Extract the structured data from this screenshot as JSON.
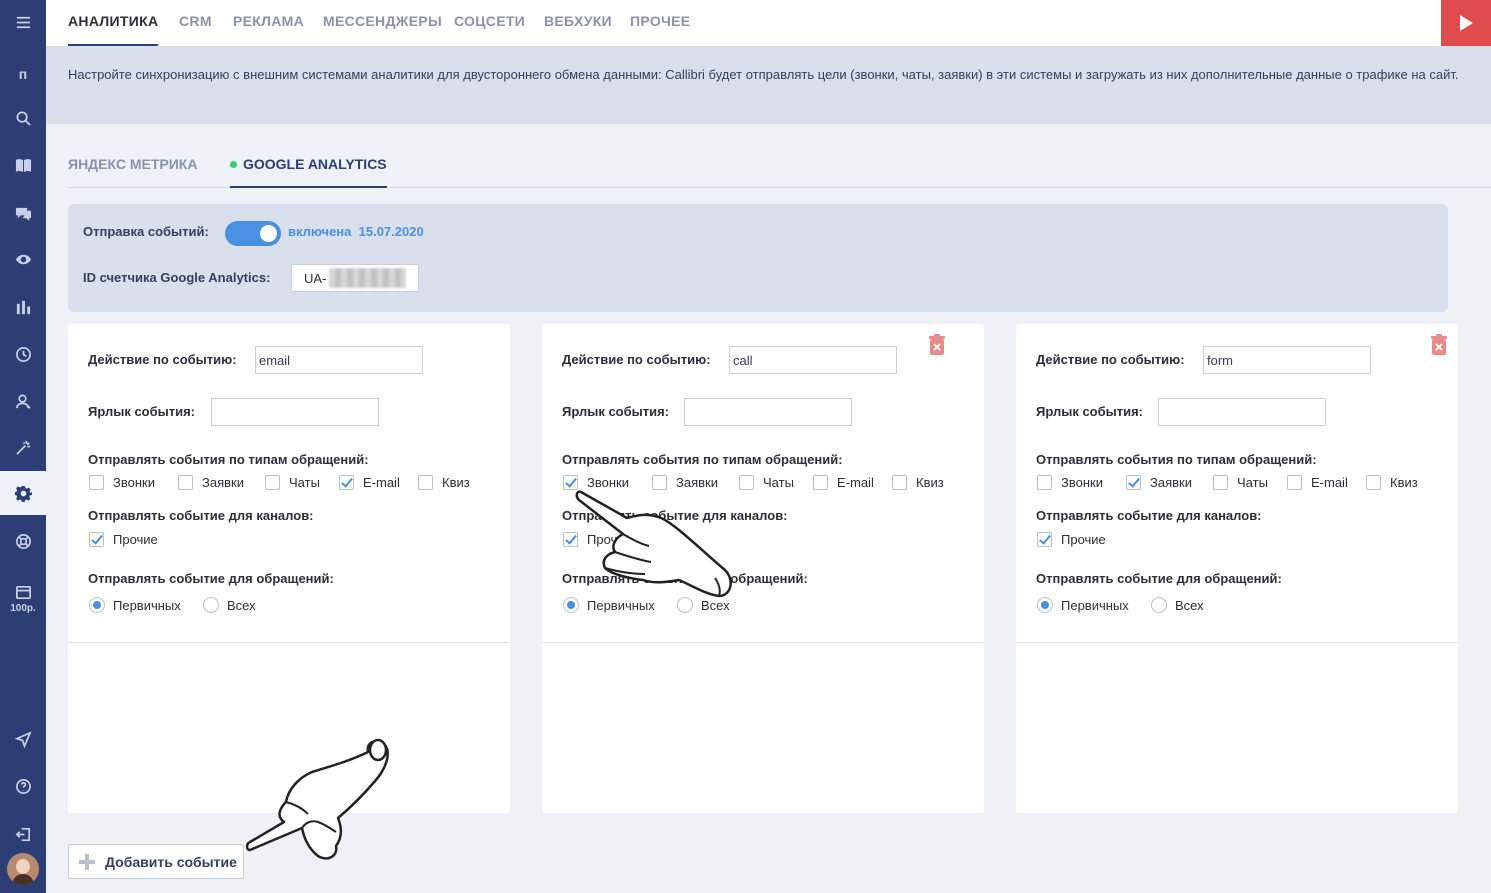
{
  "sidebar": {
    "letter": "п",
    "price": "100р."
  },
  "topnav": {
    "tabs": [
      "АНАЛИТИКА",
      "CRM",
      "РЕКЛАМА",
      "МЕССЕНДЖЕРЫ",
      "СОЦСЕТИ",
      "ВЕБХУКИ",
      "ПРОЧЕЕ"
    ],
    "active_tab": "АНАЛИТИКА"
  },
  "banner": {
    "text": "Настройте синхронизацию с внешним системами аналитики для двустороннего обмена данными: Callibri будет отправлять цели (звонки, чаты, заявки) в эти системы и загружать из них дополнительные данные о трафике на сайт."
  },
  "subtabs": {
    "yandex": "ЯНДЕКС МЕТРИКА",
    "google": "GOOGLE ANALYTICS",
    "active": "GOOGLE ANALYTICS"
  },
  "settings": {
    "send_events_label": "Отправка событий:",
    "status_text": "включена",
    "status_date": "15.07.2020",
    "toggle_on": true,
    "counter_id_label": "ID счетчика Google Analytics:",
    "counter_id_value": "UA-"
  },
  "labels": {
    "action": "Действие по событию:",
    "event_label": "Ярлык события:",
    "send_by_types": "Отправлять события по типам обращений:",
    "send_for_channels": "Отправлять событие для каналов:",
    "send_for_requests": "Отправлять событие для обращений:",
    "type_calls": "Звонки",
    "type_requests": "Заявки",
    "type_chats": "Чаты",
    "type_email": "E-mail",
    "type_quiz": "Квиз",
    "channel_other": "Прочие",
    "req_primary": "Первичных",
    "req_all": "Всех"
  },
  "cards": [
    {
      "action_value": "email",
      "label_value": "",
      "types_checked": {
        "calls": false,
        "requests": false,
        "chats": false,
        "email": true,
        "quiz": false
      },
      "channel_other": true,
      "requests_mode": "primary",
      "deletable": false
    },
    {
      "action_value": "call",
      "label_value": "",
      "types_checked": {
        "calls": true,
        "requests": false,
        "chats": false,
        "email": false,
        "quiz": false
      },
      "channel_other": true,
      "requests_mode": "primary",
      "deletable": true
    },
    {
      "action_value": "form",
      "label_value": "",
      "types_checked": {
        "calls": false,
        "requests": true,
        "chats": false,
        "email": false,
        "quiz": false
      },
      "channel_other": true,
      "requests_mode": "primary",
      "deletable": true
    }
  ],
  "add_button": {
    "label": "Добавить событие"
  },
  "colors": {
    "sidebar": "#2c3e74",
    "accent": "#4a90e2",
    "danger": "#e04b4b",
    "online": "#37c871"
  }
}
